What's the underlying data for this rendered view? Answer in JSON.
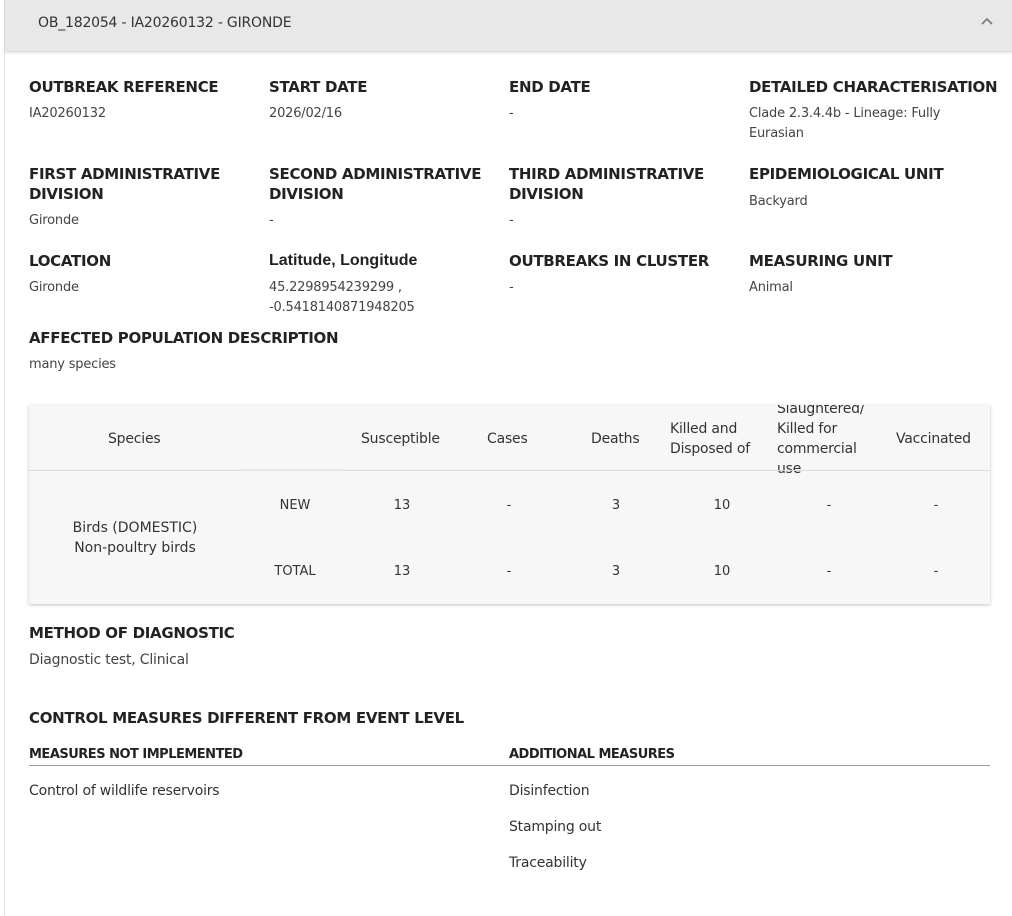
{
  "header": {
    "title": "OB_182054 - IA20260132 - GIRONDE",
    "collapse_icon": "chevron-up-icon"
  },
  "fields": {
    "outbreak_reference": {
      "label": "OUTBREAK REFERENCE",
      "value": "IA20260132"
    },
    "start_date": {
      "label": "START DATE",
      "value": "2026/02/16"
    },
    "end_date": {
      "label": "END DATE",
      "value": "-"
    },
    "detailed_characterisation": {
      "label": "DETAILED CHARACTERISATION",
      "value": "Clade 2.3.4.4b - Lineage: Fully Eurasian"
    },
    "first_admin_division": {
      "label": "FIRST ADMINISTRATIVE DIVISION",
      "value": "Gironde"
    },
    "second_admin_division": {
      "label": "SECOND ADMINISTRATIVE DIVISION",
      "value": "-"
    },
    "third_admin_division": {
      "label": "THIRD ADMINISTRATIVE DIVISION",
      "value": "-"
    },
    "epidemiological_unit": {
      "label": "EPIDEMIOLOGICAL UNIT",
      "value": "Backyard"
    },
    "location": {
      "label": "LOCATION",
      "value": "Gironde"
    },
    "lat_long": {
      "label": "Latitude, Longitude",
      "value": "45.2298954239299 , -0.5418140871948205"
    },
    "outbreaks_in_cluster": {
      "label": "OUTBREAKS IN CLUSTER",
      "value": "-"
    },
    "measuring_unit": {
      "label": "MEASURING UNIT",
      "value": "Animal"
    },
    "affected_population": {
      "label": "AFFECTED POPULATION DESCRIPTION",
      "value": "many species"
    }
  },
  "table": {
    "headers": {
      "species": "Species",
      "susceptible": "Susceptible",
      "cases": "Cases",
      "deaths": "Deaths",
      "killed": "Killed and Disposed of",
      "slaughtered": "Slaughtered/ Killed for commercial use",
      "vaccinated": "Vaccinated"
    },
    "species_name": "Birds (DOMESTIC) Non-poultry birds",
    "rows": {
      "new": {
        "label": "NEW",
        "susceptible": "13",
        "cases": "-",
        "deaths": "3",
        "killed": "10",
        "slaughtered": "-",
        "vaccinated": "-"
      },
      "total": {
        "label": "TOTAL",
        "susceptible": "13",
        "cases": "-",
        "deaths": "3",
        "killed": "10",
        "slaughtered": "-",
        "vaccinated": "-"
      }
    }
  },
  "diagnostic": {
    "label": "METHOD OF DIAGNOSTIC",
    "value": "Diagnostic test, Clinical"
  },
  "control": {
    "title": "CONTROL MEASURES DIFFERENT FROM EVENT LEVEL",
    "not_implemented_label": "MEASURES NOT IMPLEMENTED",
    "not_implemented": [
      "Control of wildlife reservoirs"
    ],
    "additional_label": "ADDITIONAL MEASURES",
    "additional": [
      "Disinfection",
      "Stamping out",
      "Traceability"
    ]
  }
}
